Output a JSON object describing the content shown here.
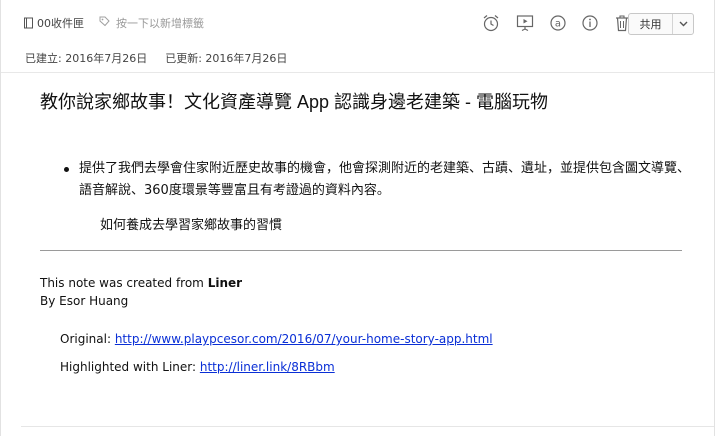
{
  "toolbar": {
    "notebook_icon": "notebook-icon",
    "notebook_name": "00收件匣",
    "tag_icon": "tag-icon",
    "tag_placeholder": "按一下以新增標籤",
    "icons": [
      "reminder-icon",
      "present-icon",
      "at-icon",
      "info-icon",
      "trash-icon"
    ],
    "share_label": "共用",
    "share_caret_icon": "chevron-down-icon"
  },
  "meta": {
    "created": "已建立: 2016年7月26日",
    "updated": "已更新: 2016年7月26日"
  },
  "note": {
    "title": "教你說家鄉故事！文化資產導覽 App 認識身邊老建築 - 電腦玩物",
    "bullets": [
      "提供了我們去學會住家附近歷史故事的機會，他會探測附近的老建築、古蹟、遺址，並提供包含圖文導覽、語音解說、360度環景等豐富且有考證過的資料內容。"
    ],
    "subtext": "如何養成去學習家鄉故事的習慣",
    "credit_prefix": "This note was created from ",
    "credit_app": "Liner",
    "credit_author": "By Esor Huang",
    "original_label": "Original: ",
    "original_url": "http://www.playpcesor.com/2016/07/your-home-story-app.html",
    "highlighted_label": "Highlighted with Liner: ",
    "highlighted_url": "http://liner.link/8RBbm"
  },
  "colors": {
    "link": "#0a2fd6",
    "muted": "#9a9a9a"
  }
}
